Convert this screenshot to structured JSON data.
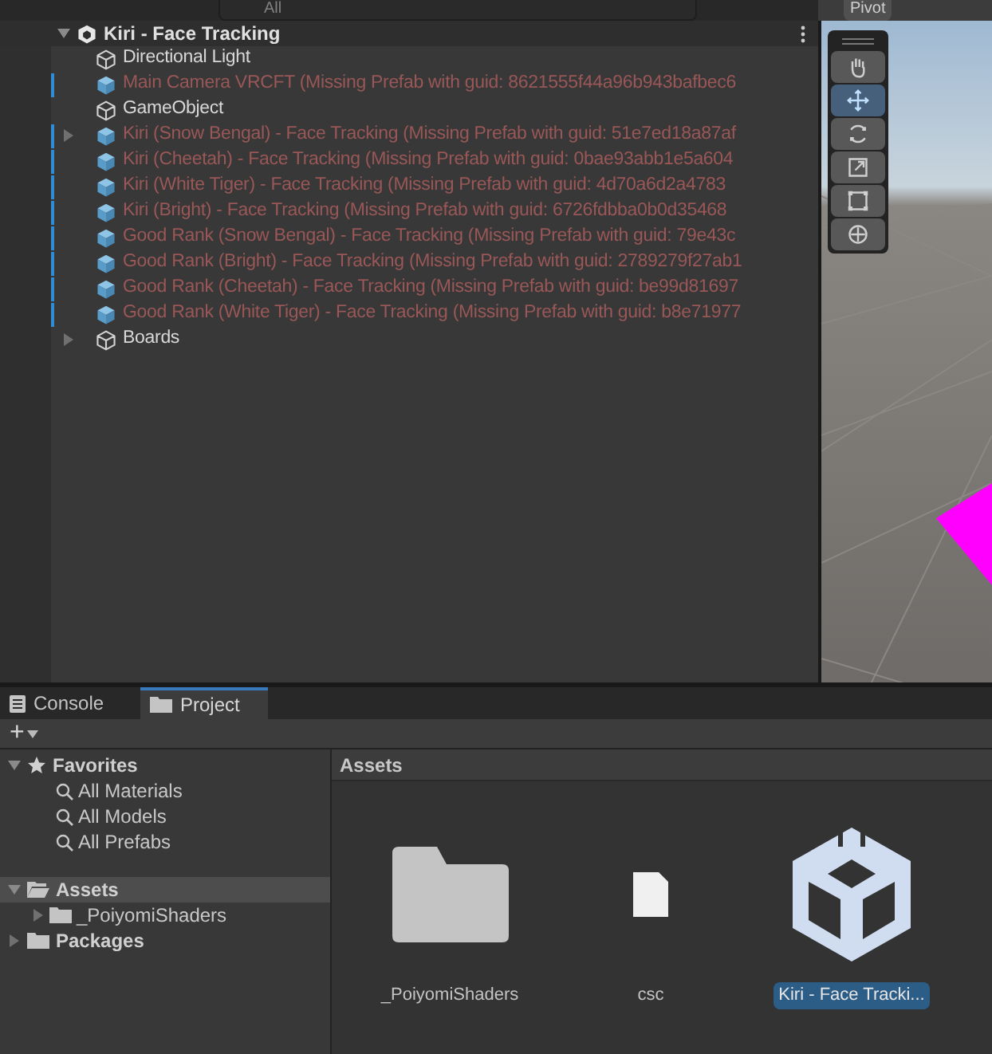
{
  "top_bar": {
    "search": {
      "placeholder": "All"
    },
    "pivot_button": "Pivot"
  },
  "hierarchy": {
    "scene": {
      "name": "Kiri - Face Tracking",
      "expanded": true
    },
    "items": [
      {
        "name": "Directional Light",
        "kind": "object",
        "missing": false,
        "modified": false,
        "has_children": false
      },
      {
        "name": "Main Camera VRCFT (Missing Prefab with guid: 8621555f44a96b943bafbec6",
        "kind": "prefab",
        "missing": true,
        "modified": true,
        "has_children": false
      },
      {
        "name": "GameObject",
        "kind": "object",
        "missing": false,
        "modified": false,
        "has_children": false
      },
      {
        "name": "Kiri (Snow Bengal) - Face Tracking (Missing Prefab with guid: 51e7ed18a87af",
        "kind": "prefab",
        "missing": true,
        "modified": true,
        "has_children": true
      },
      {
        "name": "Kiri (Cheetah) - Face Tracking (Missing Prefab with guid: 0bae93abb1e5a604",
        "kind": "prefab",
        "missing": true,
        "modified": true,
        "has_children": false
      },
      {
        "name": "Kiri (White Tiger) - Face Tracking (Missing Prefab with guid: 4d70a6d2a4783",
        "kind": "prefab",
        "missing": true,
        "modified": true,
        "has_children": false
      },
      {
        "name": "Kiri (Bright) - Face Tracking (Missing Prefab with guid: 6726fdbba0b0d35468",
        "kind": "prefab",
        "missing": true,
        "modified": true,
        "has_children": false
      },
      {
        "name": "Good Rank (Snow Bengal) - Face Tracking (Missing Prefab with guid: 79e43c",
        "kind": "prefab",
        "missing": true,
        "modified": true,
        "has_children": false
      },
      {
        "name": "Good Rank (Bright) - Face Tracking (Missing Prefab with guid: 2789279f27ab1",
        "kind": "prefab",
        "missing": true,
        "modified": true,
        "has_children": false
      },
      {
        "name": "Good Rank (Cheetah) - Face Tracking (Missing Prefab with guid: be99d81697",
        "kind": "prefab",
        "missing": true,
        "modified": true,
        "has_children": false
      },
      {
        "name": "Good Rank (White Tiger) - Face Tracking (Missing Prefab with guid: b8e71977",
        "kind": "prefab",
        "missing": true,
        "modified": true,
        "has_children": false
      },
      {
        "name": "Boards",
        "kind": "object",
        "missing": false,
        "modified": false,
        "has_children": true
      }
    ]
  },
  "scene_tools": [
    {
      "kind": "hand",
      "selected": false
    },
    {
      "kind": "move",
      "selected": true
    },
    {
      "kind": "rotate",
      "selected": false
    },
    {
      "kind": "scale",
      "selected": false
    },
    {
      "kind": "rect",
      "selected": false
    },
    {
      "kind": "transform",
      "selected": false
    }
  ],
  "bottom_tabs": [
    {
      "label": "Console",
      "kind": "console",
      "selected": false
    },
    {
      "label": "Project",
      "kind": "project",
      "selected": true
    }
  ],
  "add_button": "+",
  "project_tree": [
    {
      "label": "Favorites",
      "kind": "favorites",
      "expanded": true,
      "selected": false,
      "children": [
        {
          "label": "All Materials",
          "kind": "search"
        },
        {
          "label": "All Models",
          "kind": "search"
        },
        {
          "label": "All Prefabs",
          "kind": "search"
        }
      ]
    },
    {
      "label": "Assets",
      "kind": "folder",
      "expanded": true,
      "selected": true,
      "children": [
        {
          "label": "_PoiyomiShaders",
          "kind": "folder"
        }
      ]
    },
    {
      "label": "Packages",
      "kind": "folder",
      "expanded": false,
      "selected": false
    }
  ],
  "assets_header": "Assets",
  "assets": [
    {
      "label": "_PoiyomiShaders",
      "kind": "folder",
      "selected": false
    },
    {
      "label": "csc",
      "kind": "file",
      "selected": false
    },
    {
      "label": "Kiri - Face Tracki...",
      "kind": "scene",
      "selected": true
    }
  ]
}
